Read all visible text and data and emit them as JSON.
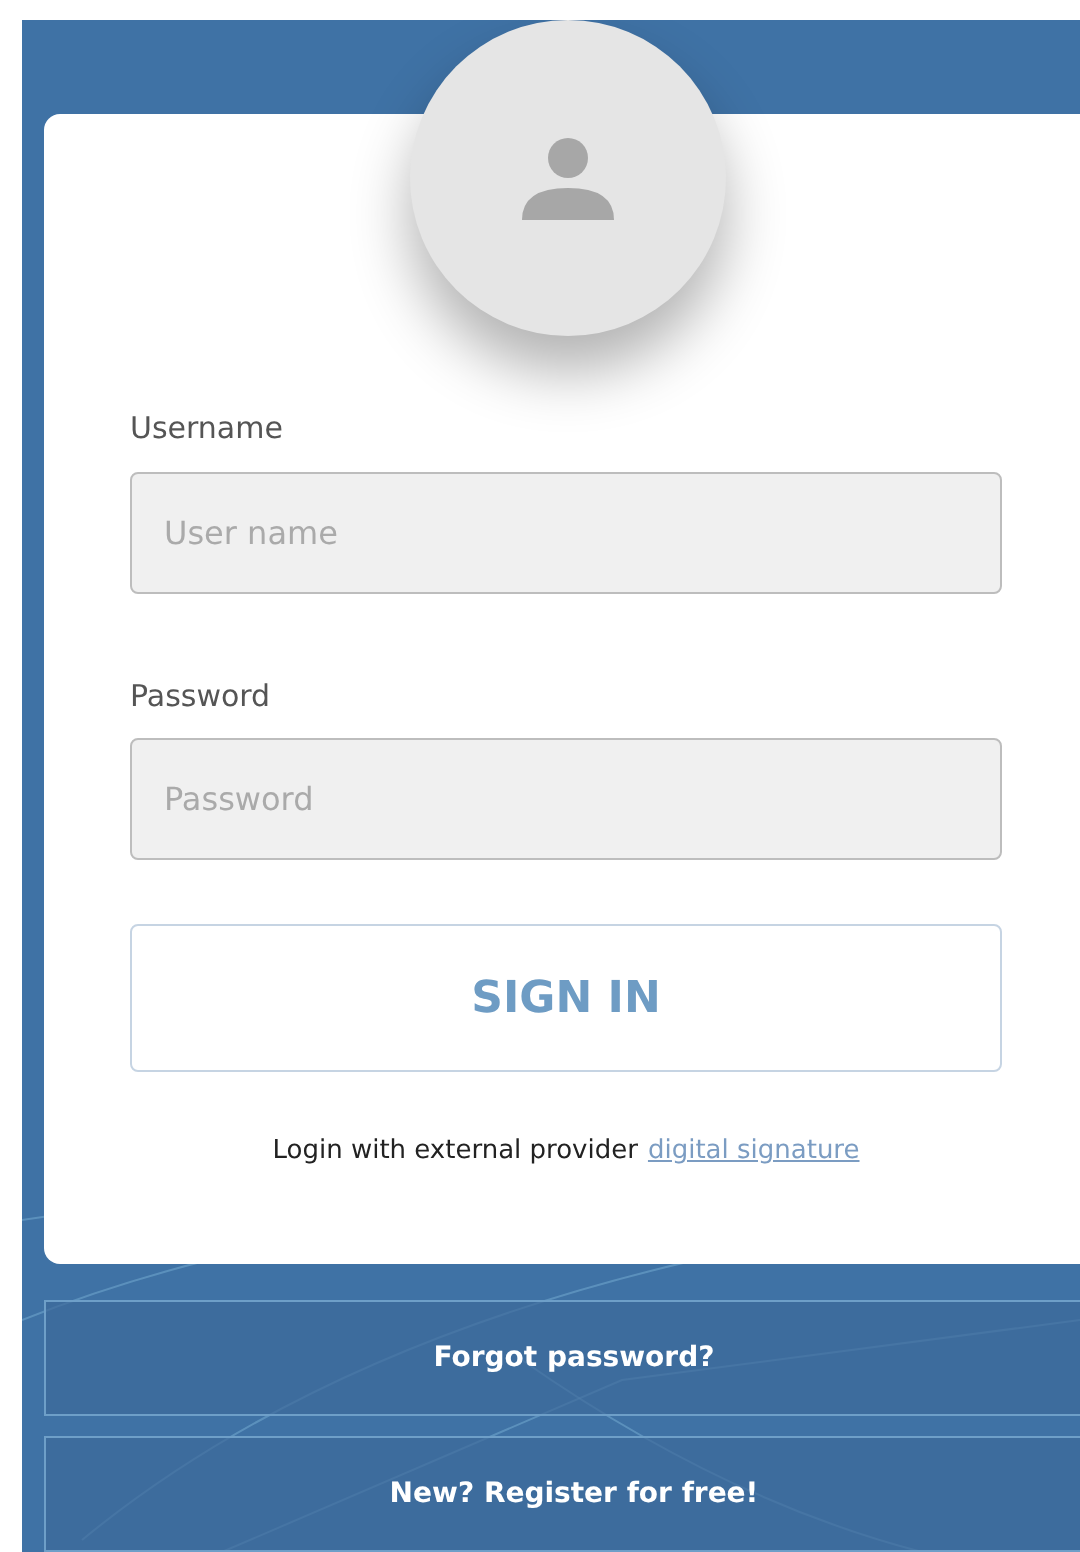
{
  "form": {
    "username": {
      "label": "Username",
      "placeholder": "User name"
    },
    "password": {
      "label": "Password",
      "placeholder": "Password"
    },
    "submit": "SIGN IN",
    "external": {
      "text": "Login with external provider",
      "link": "digital signature"
    }
  },
  "links": [
    "Forgot password?",
    "New? Register for free!"
  ]
}
